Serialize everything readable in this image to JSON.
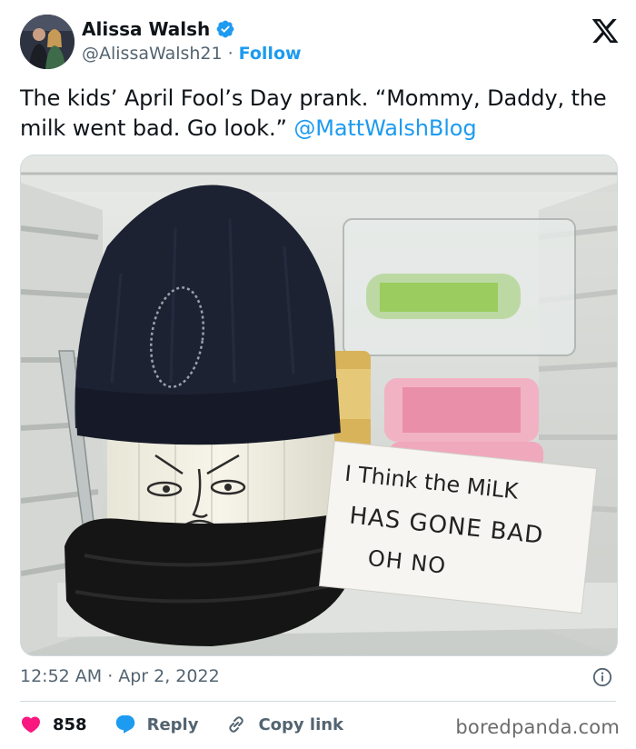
{
  "author": {
    "name": "Alissa Walsh",
    "handle": "@AlissaWalsh21",
    "separator": "·",
    "follow_label": "Follow"
  },
  "icons": {
    "verified": "verified-badge-icon",
    "platform_logo": "x-logo-icon",
    "info": "info-icon",
    "like": "heart-icon",
    "reply": "reply-bubble-icon",
    "copy_link": "link-icon"
  },
  "tweet": {
    "text": "The kids’ April Fool’s Day prank. “Mommy, Daddy, the milk went bad. Go look.” ",
    "mention": "@MattWalshBlog"
  },
  "photo": {
    "sign_lines": [
      "I Think the MiLK",
      "HAS GONE BAD",
      "OH NO"
    ]
  },
  "meta": {
    "time": "12:52 AM",
    "separator": "·",
    "date": "Apr 2, 2022"
  },
  "actions": {
    "likes": "858",
    "reply_label": "Reply",
    "copy_link_label": "Copy link"
  },
  "watermark": "boredpanda.com",
  "colors": {
    "accent": "#1d9bf0",
    "like": "#f91880",
    "muted": "#536471",
    "text": "#0f1419"
  }
}
